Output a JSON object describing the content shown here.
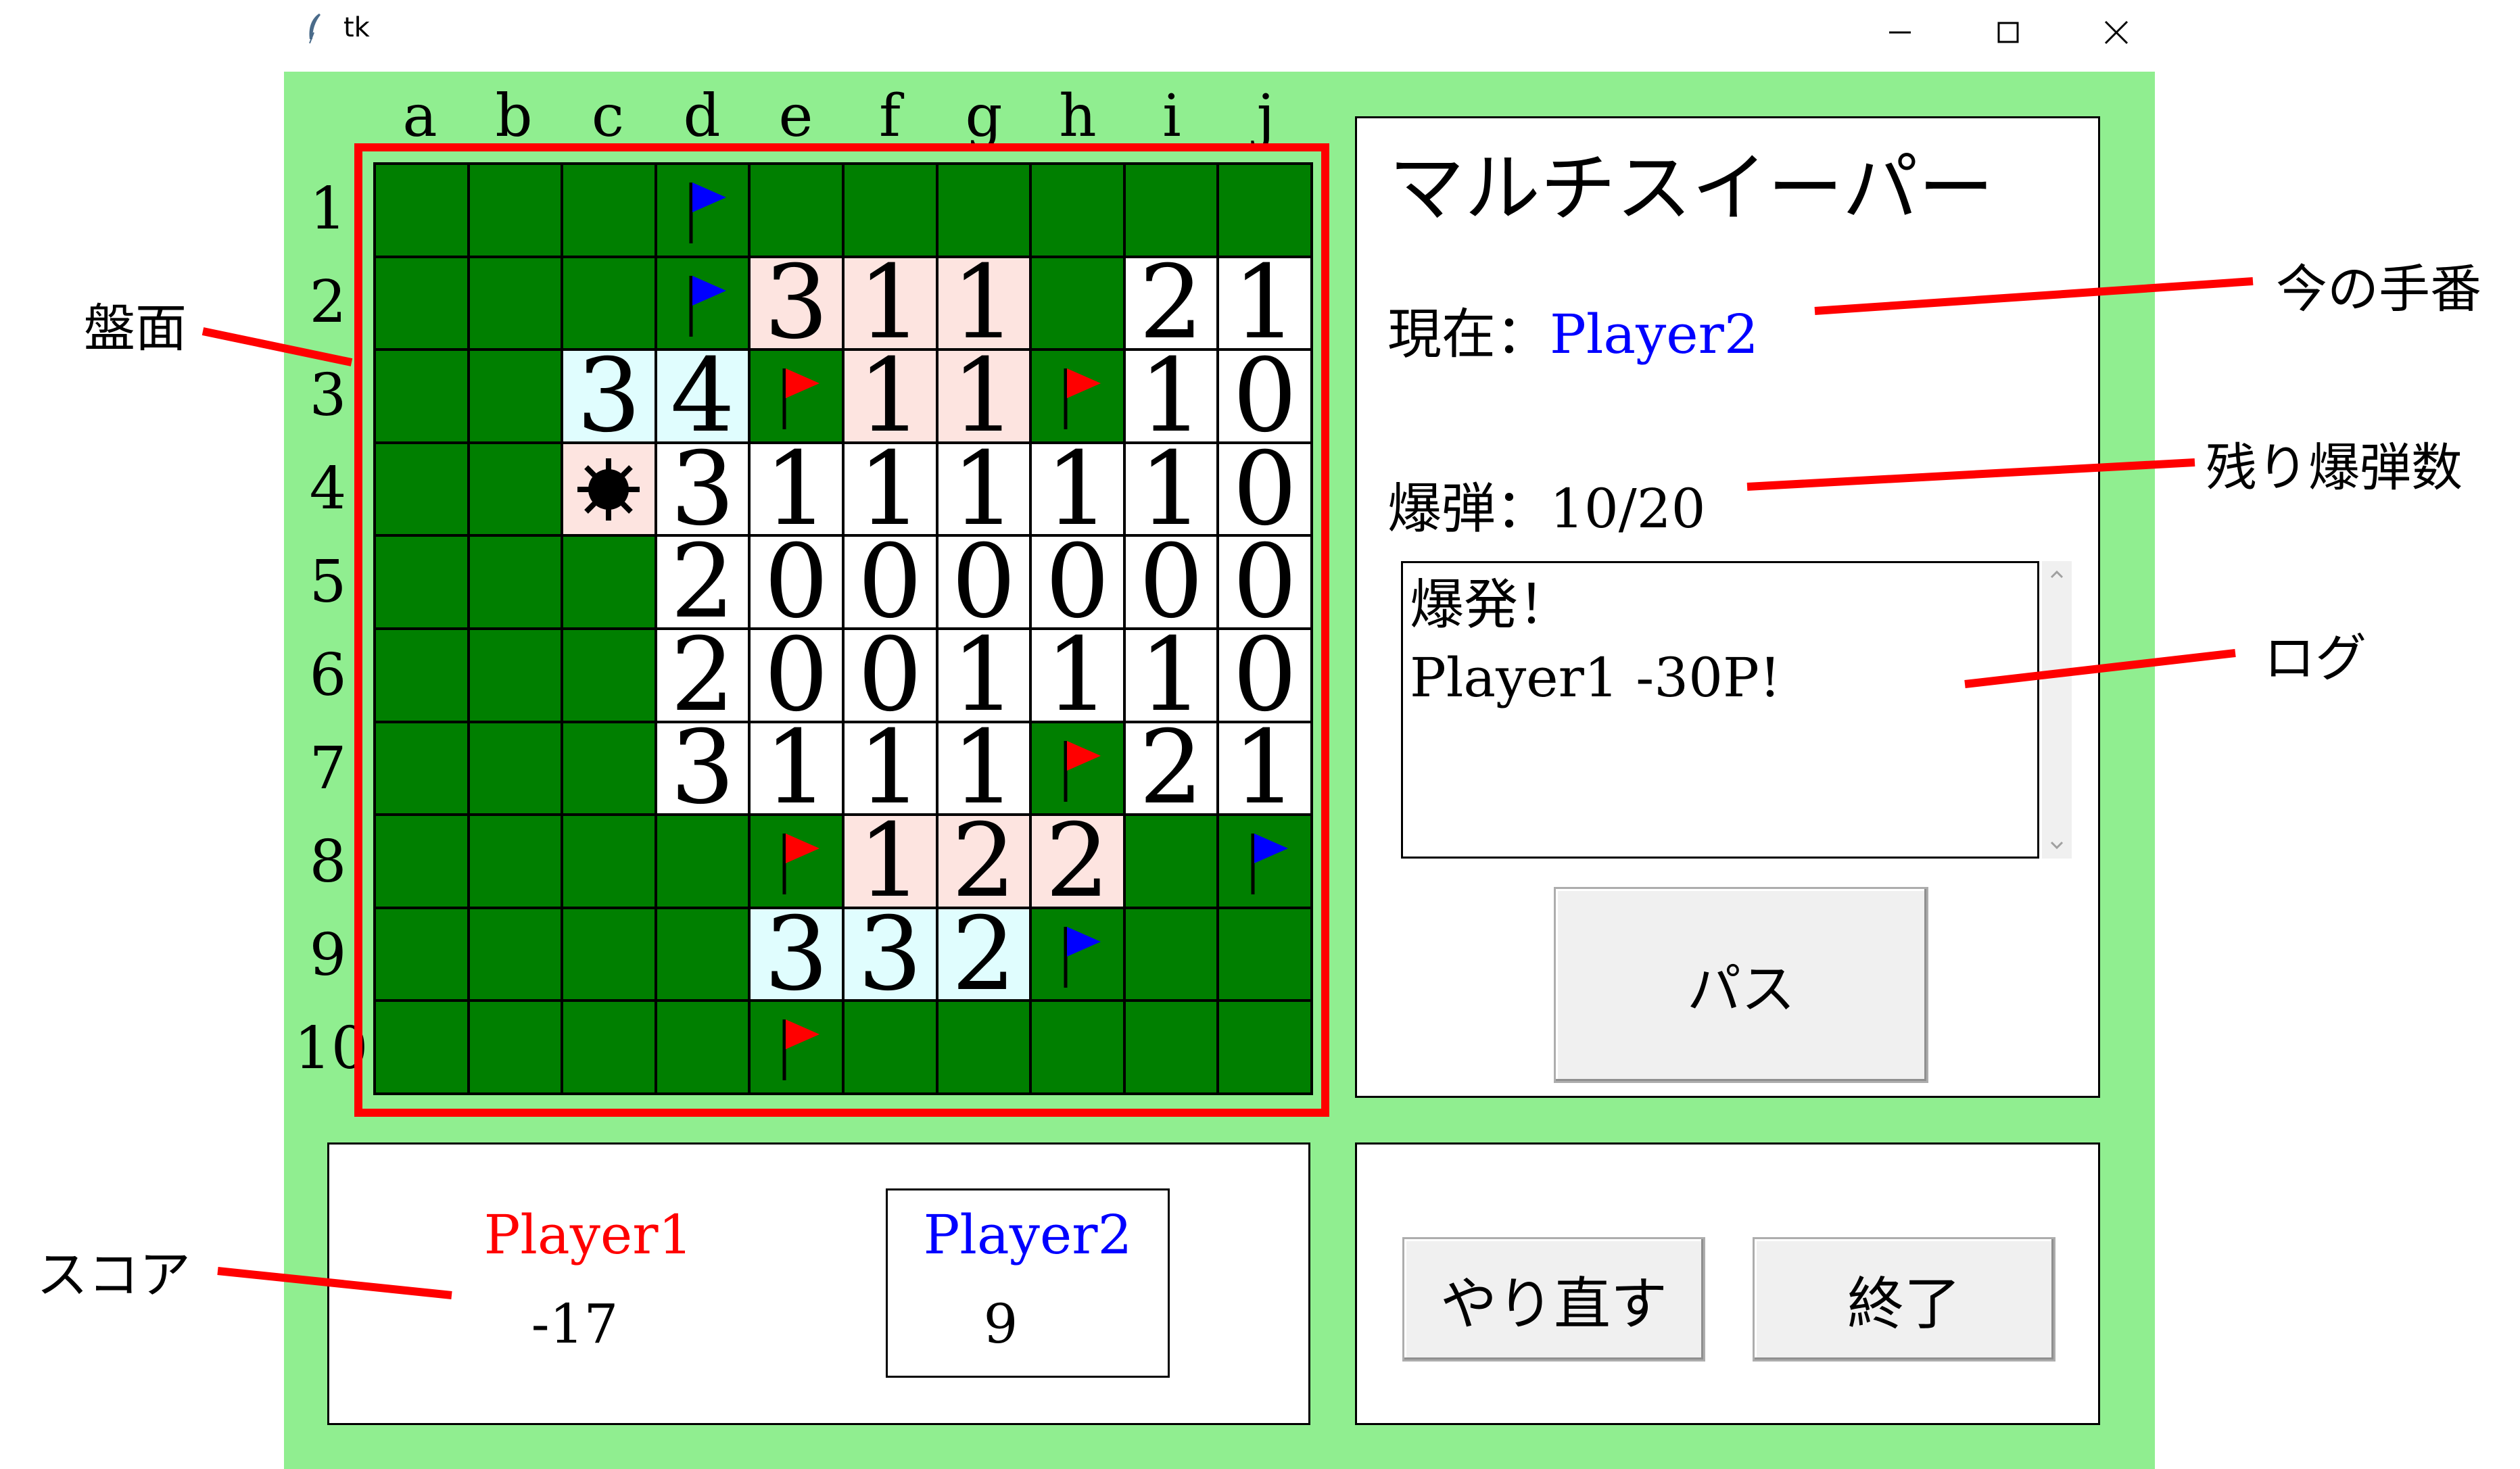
{
  "window": {
    "title": "tk",
    "minimize_icon": "minimize-icon",
    "maximize_icon": "maximize-icon",
    "close_icon": "close-icon"
  },
  "board": {
    "columns": [
      "a",
      "b",
      "c",
      "d",
      "e",
      "f",
      "g",
      "h",
      "i",
      "j"
    ],
    "rows": [
      "1",
      "2",
      "3",
      "4",
      "5",
      "6",
      "7",
      "8",
      "9",
      "10"
    ],
    "cells": [
      [
        {
          "t": "g"
        },
        {
          "t": "g"
        },
        {
          "t": "g"
        },
        {
          "t": "g",
          "flag": "blue"
        },
        {
          "t": "g"
        },
        {
          "t": "g"
        },
        {
          "t": "g"
        },
        {
          "t": "g"
        },
        {
          "t": "g"
        },
        {
          "t": "g"
        }
      ],
      [
        {
          "t": "g"
        },
        {
          "t": "g"
        },
        {
          "t": "g"
        },
        {
          "t": "g",
          "flag": "blue"
        },
        {
          "t": "p",
          "v": "3"
        },
        {
          "t": "p",
          "v": "1"
        },
        {
          "t": "p",
          "v": "1"
        },
        {
          "t": "g"
        },
        {
          "t": "w",
          "v": "2"
        },
        {
          "t": "w",
          "v": "1"
        }
      ],
      [
        {
          "t": "g"
        },
        {
          "t": "g"
        },
        {
          "t": "c",
          "v": "3"
        },
        {
          "t": "c",
          "v": "4"
        },
        {
          "t": "g",
          "flag": "red"
        },
        {
          "t": "p",
          "v": "1"
        },
        {
          "t": "p",
          "v": "1"
        },
        {
          "t": "g",
          "flag": "red"
        },
        {
          "t": "w",
          "v": "1"
        },
        {
          "t": "w",
          "v": "0"
        }
      ],
      [
        {
          "t": "g"
        },
        {
          "t": "g"
        },
        {
          "t": "p",
          "mine": true
        },
        {
          "t": "w",
          "v": "3"
        },
        {
          "t": "w",
          "v": "1"
        },
        {
          "t": "w",
          "v": "1"
        },
        {
          "t": "w",
          "v": "1"
        },
        {
          "t": "w",
          "v": "1"
        },
        {
          "t": "w",
          "v": "1"
        },
        {
          "t": "w",
          "v": "0"
        }
      ],
      [
        {
          "t": "g"
        },
        {
          "t": "g"
        },
        {
          "t": "g"
        },
        {
          "t": "w",
          "v": "2"
        },
        {
          "t": "w",
          "v": "0"
        },
        {
          "t": "w",
          "v": "0"
        },
        {
          "t": "w",
          "v": "0"
        },
        {
          "t": "w",
          "v": "0"
        },
        {
          "t": "w",
          "v": "0"
        },
        {
          "t": "w",
          "v": "0"
        }
      ],
      [
        {
          "t": "g"
        },
        {
          "t": "g"
        },
        {
          "t": "g"
        },
        {
          "t": "w",
          "v": "2"
        },
        {
          "t": "w",
          "v": "0"
        },
        {
          "t": "w",
          "v": "0"
        },
        {
          "t": "w",
          "v": "1"
        },
        {
          "t": "w",
          "v": "1"
        },
        {
          "t": "w",
          "v": "1"
        },
        {
          "t": "w",
          "v": "0"
        }
      ],
      [
        {
          "t": "g"
        },
        {
          "t": "g"
        },
        {
          "t": "g"
        },
        {
          "t": "w",
          "v": "3"
        },
        {
          "t": "w",
          "v": "1"
        },
        {
          "t": "w",
          "v": "1"
        },
        {
          "t": "w",
          "v": "1"
        },
        {
          "t": "g",
          "flag": "red"
        },
        {
          "t": "w",
          "v": "2"
        },
        {
          "t": "w",
          "v": "1"
        }
      ],
      [
        {
          "t": "g"
        },
        {
          "t": "g"
        },
        {
          "t": "g"
        },
        {
          "t": "g"
        },
        {
          "t": "g",
          "flag": "red"
        },
        {
          "t": "p",
          "v": "1"
        },
        {
          "t": "p",
          "v": "2"
        },
        {
          "t": "p",
          "v": "2"
        },
        {
          "t": "g"
        },
        {
          "t": "g",
          "flag": "blue"
        }
      ],
      [
        {
          "t": "g"
        },
        {
          "t": "g"
        },
        {
          "t": "g"
        },
        {
          "t": "g"
        },
        {
          "t": "c",
          "v": "3"
        },
        {
          "t": "c",
          "v": "3"
        },
        {
          "t": "c",
          "v": "2"
        },
        {
          "t": "g",
          "flag": "blue"
        },
        {
          "t": "g"
        },
        {
          "t": "g"
        }
      ],
      [
        {
          "t": "g"
        },
        {
          "t": "g"
        },
        {
          "t": "g"
        },
        {
          "t": "g"
        },
        {
          "t": "g",
          "flag": "red"
        },
        {
          "t": "g"
        },
        {
          "t": "g"
        },
        {
          "t": "g"
        },
        {
          "t": "g"
        },
        {
          "t": "g"
        }
      ]
    ]
  },
  "colors": {
    "app_bg": "#90ee90",
    "covered_cell": "#007f00",
    "revealed_cell": "#ffffff",
    "player1_cell": "#fde4e0",
    "player2_cell": "#e0fdfe",
    "player1": "#ff0000",
    "player2": "#0000ff",
    "annotation_line": "#ff0000"
  },
  "info": {
    "title": "マルチスイーパー",
    "turn_label": "現在：",
    "turn_value": "Player2",
    "bomb_label": "爆弾：",
    "bomb_value": "10/20",
    "log_lines": [
      "爆発！",
      "Player1 -30P!"
    ],
    "pass_label": "パス"
  },
  "score": {
    "player1_name": "Player1",
    "player1_score": "-17",
    "player2_name": "Player2",
    "player2_score": "9"
  },
  "controls": {
    "retry_label": "やり直す",
    "quit_label": "終了"
  },
  "annotations": {
    "board": "盤面",
    "turn": "今の手番",
    "bombs": "残り爆弾数",
    "log": "ログ",
    "score": "スコア"
  }
}
